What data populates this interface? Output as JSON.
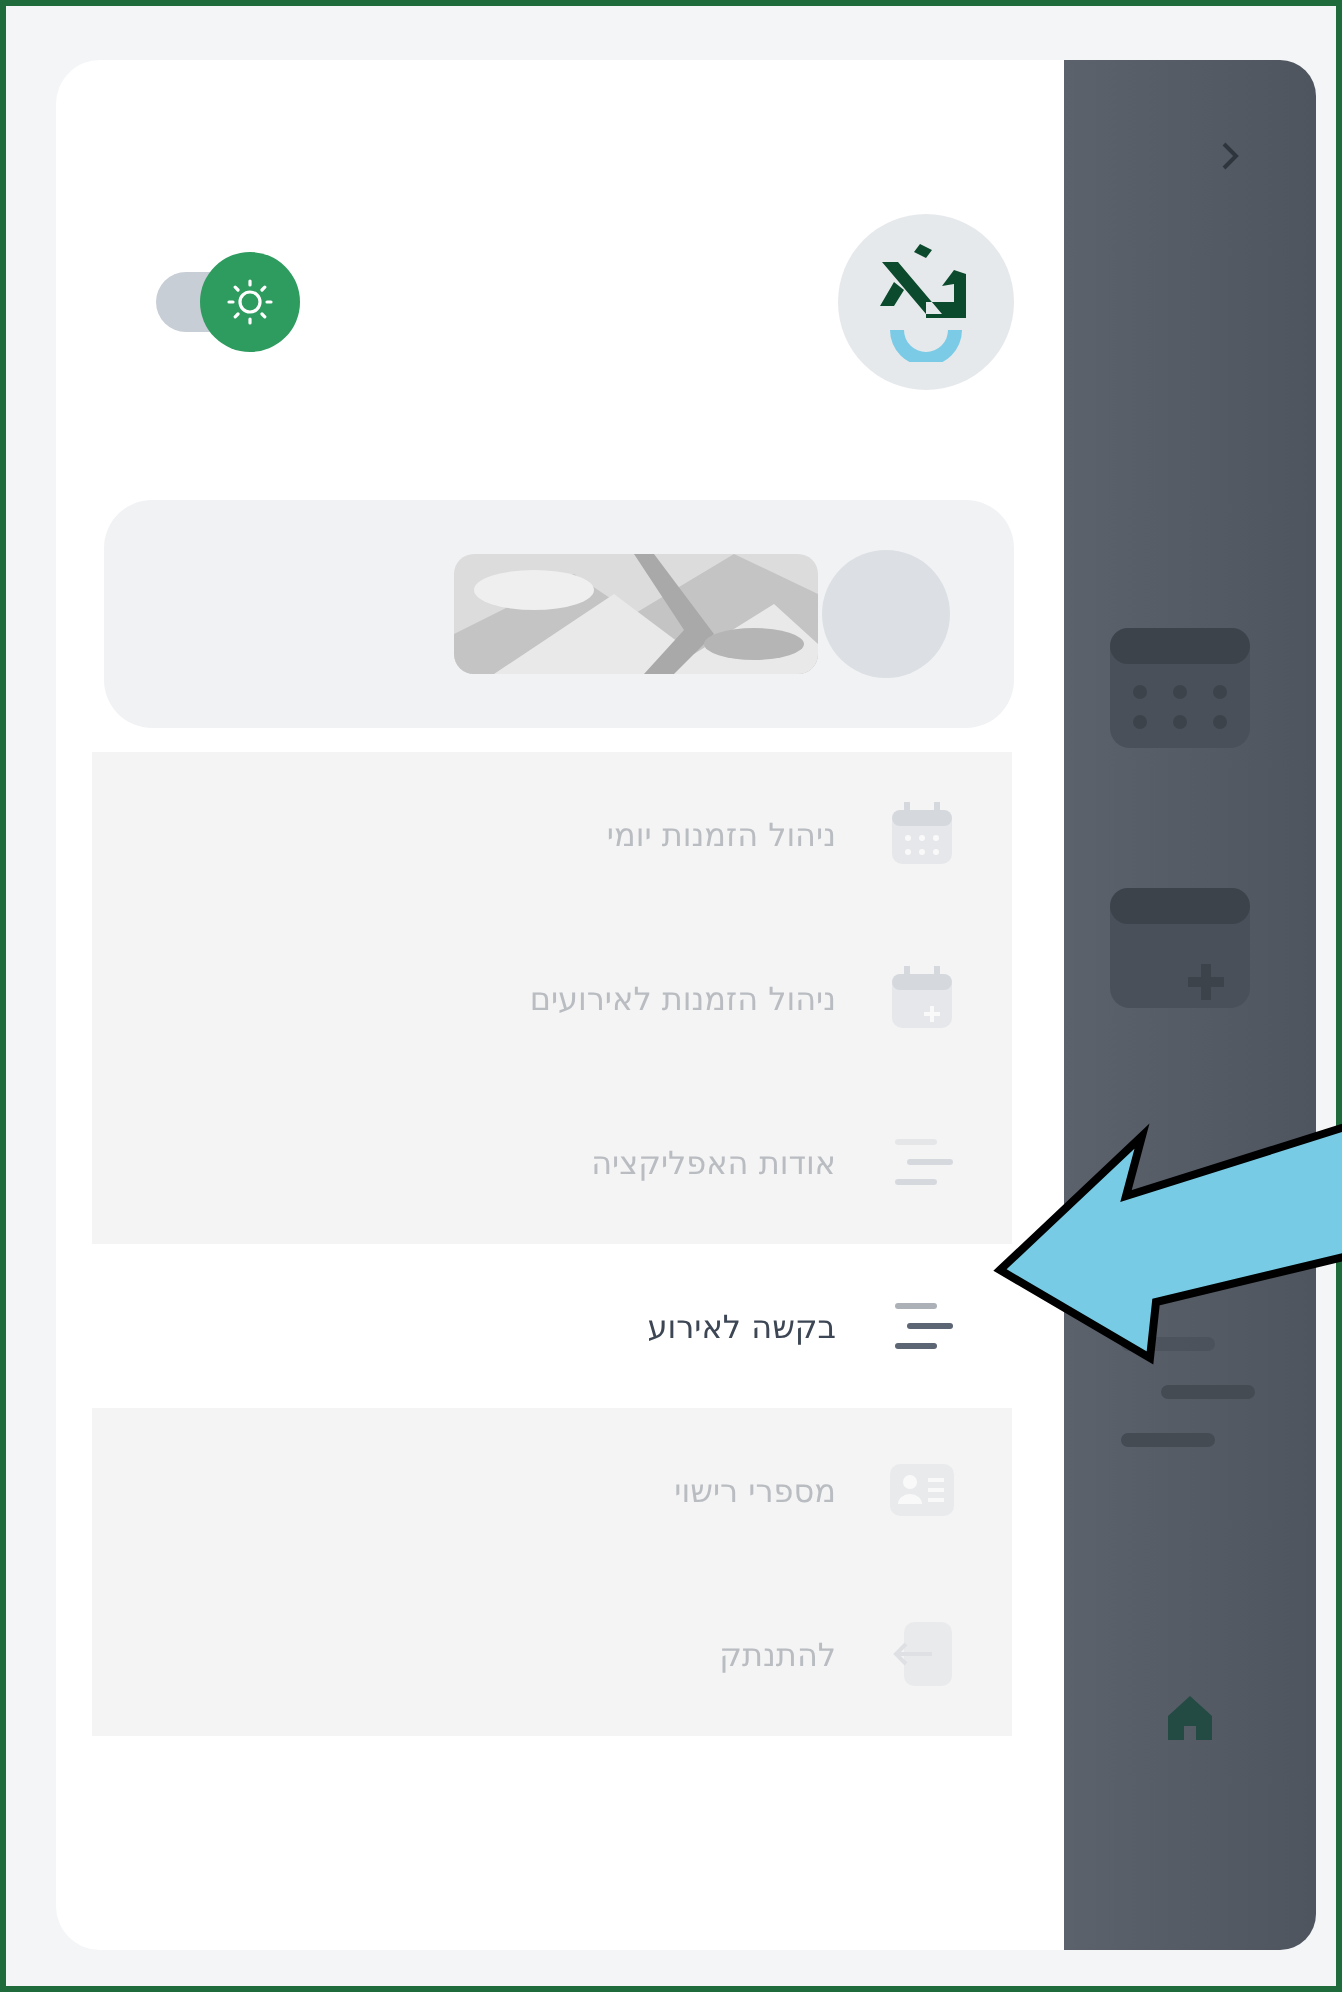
{
  "theme_toggle": {
    "on": true
  },
  "menu": [
    {
      "label": "ניהול הזמנות יומי",
      "highlighted": false
    },
    {
      "label": "ניהול הזמנות לאירועים",
      "highlighted": false
    },
    {
      "label": "אודות האפליקציה",
      "highlighted": false
    },
    {
      "label": "בקשה לאירוע",
      "highlighted": true
    },
    {
      "label": "מספרי רישוי",
      "highlighted": false
    },
    {
      "label": "להתנתק",
      "highlighted": false
    }
  ]
}
